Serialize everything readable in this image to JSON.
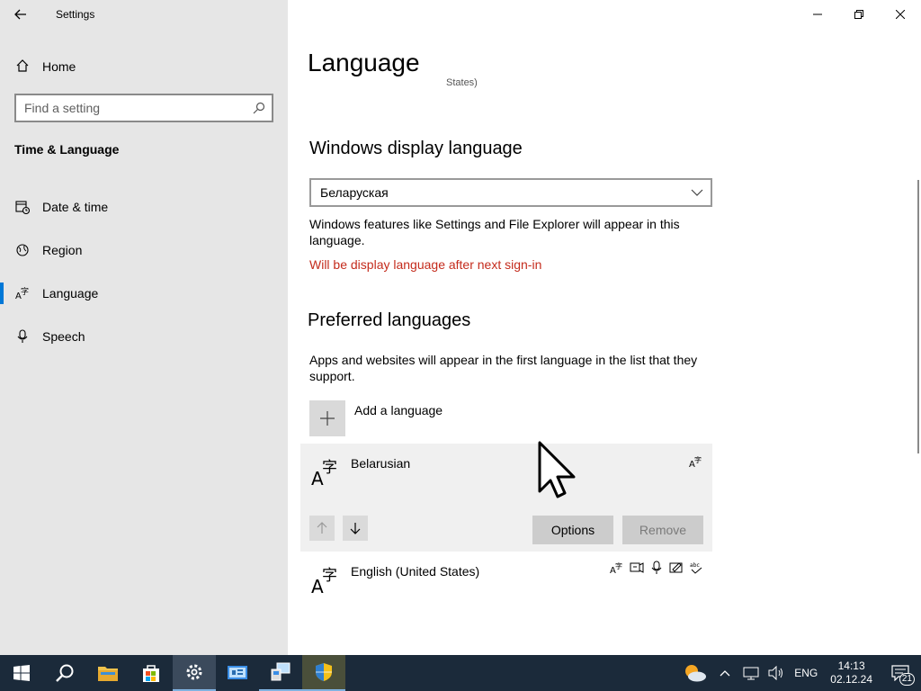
{
  "window": {
    "title": "Settings"
  },
  "sidebar": {
    "home_label": "Home",
    "search_placeholder": "Find a setting",
    "section_heading": "Time & Language",
    "items": [
      {
        "label": "Date & time",
        "icon": "date-time-icon"
      },
      {
        "label": "Region",
        "icon": "globe-icon"
      },
      {
        "label": "Language",
        "icon": "language-icon",
        "active": true
      },
      {
        "label": "Speech",
        "icon": "microphone-icon"
      }
    ]
  },
  "main": {
    "page_title": "Language",
    "clipped_text": "States)",
    "display_language": {
      "heading": "Windows display language",
      "selected": "Беларуская",
      "description": "Windows features like Settings and File Explorer will appear in this language.",
      "warning": "Will be display language after next sign-in"
    },
    "preferred": {
      "heading": "Preferred languages",
      "description": "Apps and websites will appear in the first language in the list that they support.",
      "add_label": "Add a language",
      "languages": [
        {
          "name": "Belarusian",
          "features": [
            "display-language-icon"
          ]
        },
        {
          "name": "English (United States)",
          "features": [
            "display-language-icon",
            "text-to-speech-icon",
            "speech-recognition-icon",
            "handwriting-icon",
            "spellcheck-icon"
          ]
        }
      ],
      "options_label": "Options",
      "remove_label": "Remove"
    }
  },
  "taskbar": {
    "tray": {
      "input_language": "ENG",
      "time": "14:13",
      "date": "02.12.24",
      "notification_count": "21"
    }
  },
  "colors": {
    "accent": "#0078d7",
    "warning": "#c42b1c",
    "taskbar": "#1b2a3a"
  }
}
